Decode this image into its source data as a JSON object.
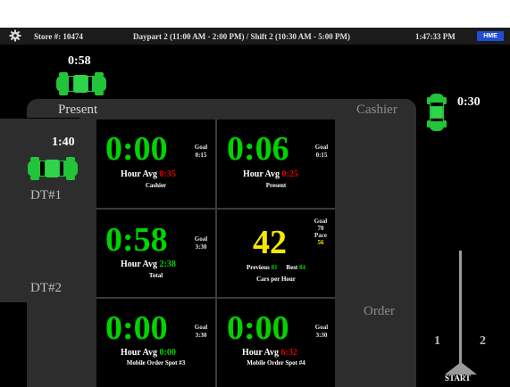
{
  "header": {
    "store": "Store #: 10474",
    "daypart": "Daypart 2 (11:00 AM - 2:00 PM) / Shift 2 (10:30 AM - 5:00 PM)",
    "time": "1:47:33 PM",
    "brand": "HME"
  },
  "cars": {
    "top_timer": "0:58",
    "dt1_timer": "1:40",
    "right_timer": "0:30"
  },
  "labels": {
    "present": "Present",
    "cashier": "Cashier",
    "order": "Order",
    "dt1": "DT#1",
    "dt2": "DT#2",
    "lane1": "1",
    "lane2": "2",
    "start": "START"
  },
  "tiles": {
    "cashier": {
      "time": "0:00",
      "goal_label": "Goal",
      "goal": "0:15",
      "avg_label": "Hour Avg",
      "avg": "0:35",
      "name": "Cashier"
    },
    "present": {
      "time": "0:06",
      "goal_label": "Goal",
      "goal": "0:15",
      "avg_label": "Hour Avg",
      "avg": "0:25",
      "name": "Present"
    },
    "total": {
      "time": "0:58",
      "goal_label": "Goal",
      "goal": "3:30",
      "avg_label": "Hour Avg",
      "avg": "2:38",
      "name": "Total"
    },
    "cph": {
      "value": "42",
      "goal_label": "Goal",
      "goal": "70",
      "pace_label": "Pace",
      "pace": "56",
      "previous_label": "Previous",
      "previous": "81",
      "best_label": "Best",
      "best": "84",
      "name": "Cars per Hour"
    },
    "mobile3": {
      "time": "0:00",
      "goal_label": "Goal",
      "goal": "3:30",
      "avg_label": "Hour Avg",
      "avg": "0:00",
      "name": "Mobile Order Spot #3"
    },
    "mobile4": {
      "time": "0:00",
      "goal_label": "Goal",
      "goal": "3:30",
      "avg_label": "Hour Avg",
      "avg": "6:32",
      "name": "Mobile Order Spot #4"
    }
  },
  "colors": {
    "good": "#00d400",
    "bad": "#e00000",
    "cph": "#f5e800",
    "car": "#22c43a",
    "brand": "#1f4fd6"
  }
}
